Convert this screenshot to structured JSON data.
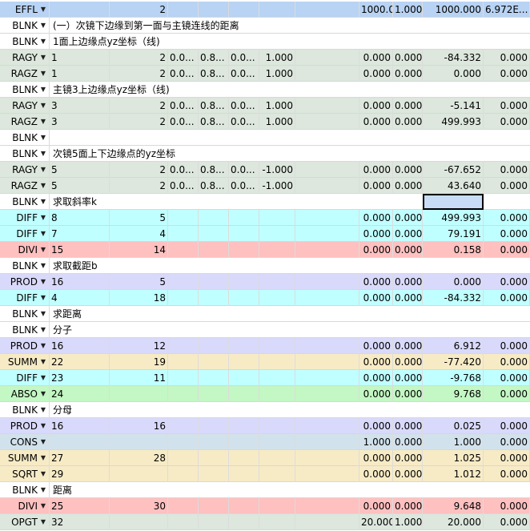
{
  "row_colors": {
    "EFFL": "#b8d3f3",
    "BLNK": "#ffffff",
    "RAGY": "#dde7dd",
    "RAGZ": "#dde7dd",
    "DIFF": "#c0ffff",
    "DIVI": "#ffc0c0",
    "PROD": "#d9d9fb",
    "SUMM": "#f7ebc6",
    "ABSO": "#c3f7c3",
    "CONS": "#d2e2ec",
    "SQRT": "#f7ebc6",
    "OPGT": "#dde7dd"
  },
  "icons": {
    "dropdown": "dropdown-arrow-icon"
  },
  "rows": [
    {
      "type": "EFFL",
      "c1": "",
      "c2": "2",
      "c3": "",
      "c4": "",
      "c5": "",
      "c6": "",
      "c7": "1000.000",
      "c8": "1.000",
      "c9": "1000.000",
      "c10": "6.972E..."
    },
    {
      "type": "BLNK",
      "comment": "(一）次镜下边缘到第一面与主镜连线的距离"
    },
    {
      "type": "BLNK",
      "comment": "1面上边缘点yz坐标（线)"
    },
    {
      "type": "RAGY",
      "c1": "1",
      "c2": "2",
      "c3": "0.0...",
      "c4": "0.8...",
      "c5": "0.0...",
      "c6": "1.000",
      "c7": "0.000",
      "c8": "0.000",
      "c9": "-84.332",
      "c10": "0.000"
    },
    {
      "type": "RAGZ",
      "c1": "1",
      "c2": "2",
      "c3": "0.0...",
      "c4": "0.8...",
      "c5": "0.0...",
      "c6": "1.000",
      "c7": "0.000",
      "c8": "0.000",
      "c9": "0.000",
      "c10": "0.000"
    },
    {
      "type": "BLNK",
      "comment": "主镜3上边缘点yz坐标（线)"
    },
    {
      "type": "RAGY",
      "c1": "3",
      "c2": "2",
      "c3": "0.0...",
      "c4": "0.8...",
      "c5": "0.0...",
      "c6": "1.000",
      "c7": "0.000",
      "c8": "0.000",
      "c9": "-5.141",
      "c10": "0.000"
    },
    {
      "type": "RAGZ",
      "c1": "3",
      "c2": "2",
      "c3": "0.0...",
      "c4": "0.8...",
      "c5": "0.0...",
      "c6": "1.000",
      "c7": "0.000",
      "c8": "0.000",
      "c9": "499.993",
      "c10": "0.000"
    },
    {
      "type": "BLNK",
      "comment": ""
    },
    {
      "type": "BLNK",
      "comment": "次镜5面上下边缘点的yz坐标"
    },
    {
      "type": "RAGY",
      "c1": "5",
      "c2": "2",
      "c3": "0.0...",
      "c4": "0.8...",
      "c5": "0.0...",
      "c6": "-1.000",
      "c7": "0.000",
      "c8": "0.000",
      "c9": "-67.652",
      "c10": "0.000"
    },
    {
      "type": "RAGZ",
      "c1": "5",
      "c2": "2",
      "c3": "0.0...",
      "c4": "0.8...",
      "c5": "0.0...",
      "c6": "-1.000",
      "c7": "0.000",
      "c8": "0.000",
      "c9": "43.640",
      "c10": "0.000"
    },
    {
      "type": "BLNK",
      "comment": "求取斜率k",
      "selected": true
    },
    {
      "type": "DIFF",
      "c1": "8",
      "c2": "5",
      "c7": "0.000",
      "c8": "0.000",
      "c9": "499.993",
      "c10": "0.000"
    },
    {
      "type": "DIFF",
      "c1": "7",
      "c2": "4",
      "c7": "0.000",
      "c8": "0.000",
      "c9": "79.191",
      "c10": "0.000"
    },
    {
      "type": "DIVI",
      "c1": "15",
      "c2": "14",
      "c7": "0.000",
      "c8": "0.000",
      "c9": "0.158",
      "c10": "0.000"
    },
    {
      "type": "BLNK",
      "comment": "求取截距b"
    },
    {
      "type": "PROD",
      "c1": "16",
      "c2": "5",
      "c7": "0.000",
      "c8": "0.000",
      "c9": "0.000",
      "c10": "0.000"
    },
    {
      "type": "DIFF",
      "c1": "4",
      "c2": "18",
      "c7": "0.000",
      "c8": "0.000",
      "c9": "-84.332",
      "c10": "0.000"
    },
    {
      "type": "BLNK",
      "comment": "求距离"
    },
    {
      "type": "BLNK",
      "comment": "分子"
    },
    {
      "type": "PROD",
      "c1": "16",
      "c2": "12",
      "c7": "0.000",
      "c8": "0.000",
      "c9": "6.912",
      "c10": "0.000"
    },
    {
      "type": "SUMM",
      "c1": "22",
      "c2": "19",
      "c7": "0.000",
      "c8": "0.000",
      "c9": "-77.420",
      "c10": "0.000"
    },
    {
      "type": "DIFF",
      "c1": "23",
      "c2": "11",
      "c7": "0.000",
      "c8": "0.000",
      "c9": "-9.768",
      "c10": "0.000"
    },
    {
      "type": "ABSO",
      "c1": "24",
      "c2": "",
      "c7": "0.000",
      "c8": "0.000",
      "c9": "9.768",
      "c10": "0.000"
    },
    {
      "type": "BLNK",
      "comment": "分母"
    },
    {
      "type": "PROD",
      "c1": "16",
      "c2": "16",
      "c7": "0.000",
      "c8": "0.000",
      "c9": "0.025",
      "c10": "0.000"
    },
    {
      "type": "CONS",
      "c1": "",
      "c2": "",
      "c7": "1.000",
      "c8": "0.000",
      "c9": "1.000",
      "c10": "0.000"
    },
    {
      "type": "SUMM",
      "c1": "27",
      "c2": "28",
      "c7": "0.000",
      "c8": "0.000",
      "c9": "1.025",
      "c10": "0.000"
    },
    {
      "type": "SQRT",
      "c1": "29",
      "c2": "",
      "c7": "0.000",
      "c8": "0.000",
      "c9": "1.012",
      "c10": "0.000"
    },
    {
      "type": "BLNK",
      "comment": "距离"
    },
    {
      "type": "DIVI",
      "c1": "25",
      "c2": "30",
      "c7": "0.000",
      "c8": "0.000",
      "c9": "9.648",
      "c10": "0.000"
    },
    {
      "type": "OPGT",
      "c1": "32",
      "c2": "",
      "c7": "20.000",
      "c8": "1.000",
      "c9": "20.000",
      "c10": "0.000"
    }
  ]
}
